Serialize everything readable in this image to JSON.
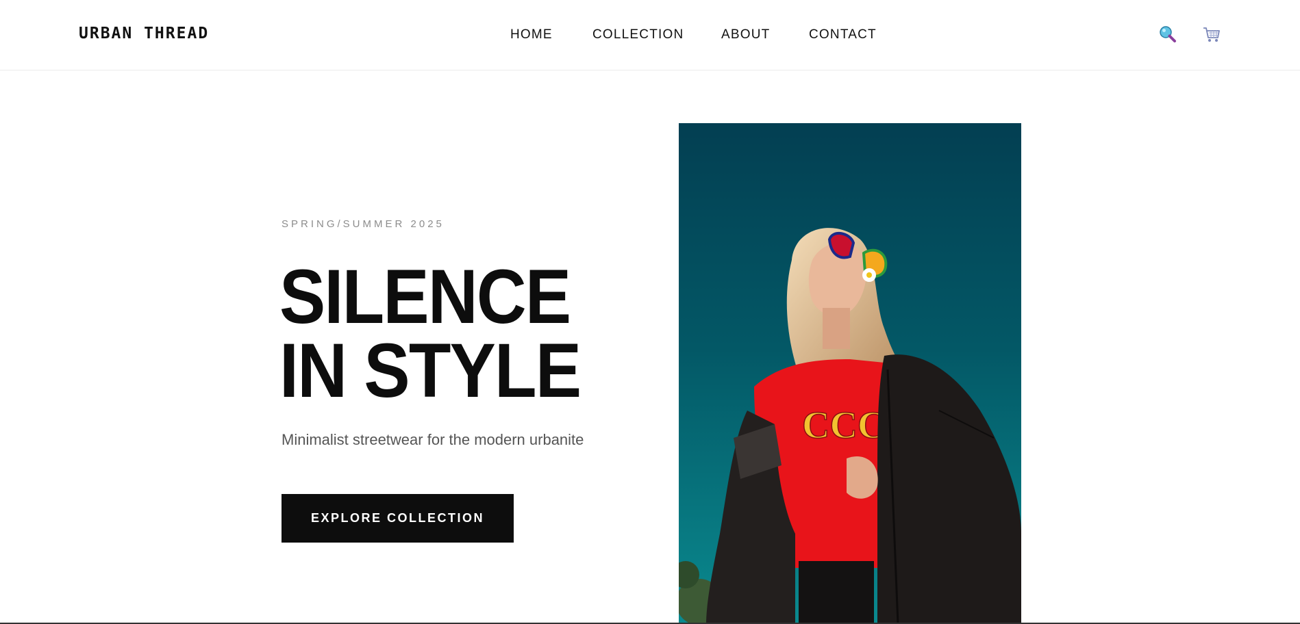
{
  "brand": {
    "logo_text": "URBAN THREAD"
  },
  "nav": {
    "items": [
      {
        "label": "HOME"
      },
      {
        "label": "COLLECTION"
      },
      {
        "label": "ABOUT"
      },
      {
        "label": "CONTACT"
      }
    ]
  },
  "header_icons": {
    "search": "search-icon",
    "cart": "cart-icon"
  },
  "hero": {
    "kicker": "SPRING/SUMMER 2025",
    "headline_line1": "SILENCE",
    "headline_line2": "IN STYLE",
    "subtitle": "Minimalist streetwear for the modern urbanite",
    "cta_label": "EXPLORE COLLECTION",
    "shirt_print": "CCC"
  },
  "colors": {
    "text": "#0d0d0d",
    "muted": "#8c8c8c",
    "cta_bg": "#0d0d0d",
    "cta_text": "#ffffff",
    "image_bg": "#045561",
    "shirt": "#e8141a"
  }
}
